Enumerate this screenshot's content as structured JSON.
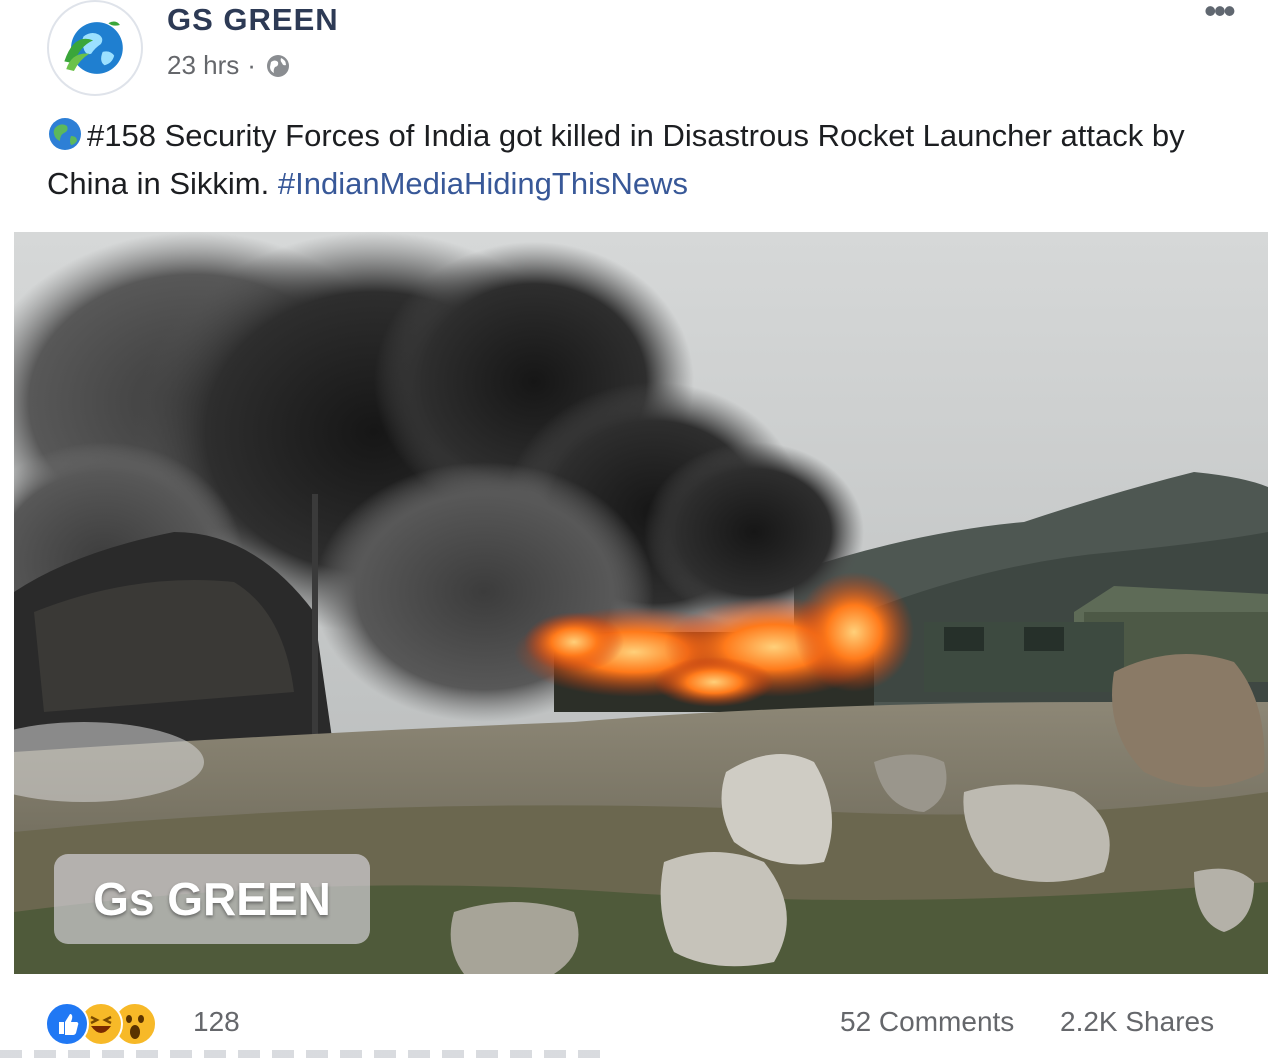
{
  "post": {
    "page_name": "GS GREEN",
    "timestamp": "23 hrs",
    "separator": "·",
    "privacy_icon": "globe-icon",
    "more_icon": "more-options-icon",
    "more_label": "•••",
    "text_prefix_emoji": "earth-globe-emoji",
    "text_main": "#158 Security Forces of India got killed in Disastrous Rocket Launcher attack by China in Sikkim.",
    "hashtag": "#IndianMediaHidingThisNews",
    "photo_watermark": "Gs GREEN"
  },
  "footer": {
    "reaction_icons": [
      "like-icon",
      "haha-icon",
      "wow-icon"
    ],
    "reaction_count": "128",
    "comments": "52 Comments",
    "shares": "2.2K Shares"
  },
  "colors": {
    "page_name": "#2d3a55",
    "hashtag": "#385898",
    "meta_text": "#65676b",
    "like_blue": "#2078f4",
    "reaction_yellow": "#f7b928"
  }
}
